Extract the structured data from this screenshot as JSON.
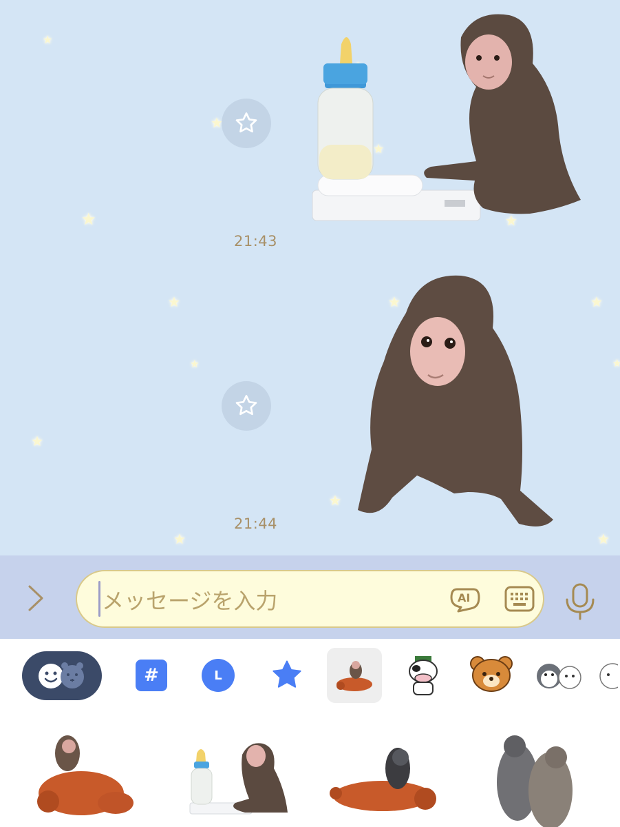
{
  "chat": {
    "messages": [
      {
        "time": "21:43",
        "sticker": "monkey-with-bottle-on-scale"
      },
      {
        "time": "21:44",
        "sticker": "baby-monkey-sitting"
      }
    ],
    "reaction_icon": "star-outline-icon"
  },
  "input": {
    "placeholder": "メッセージを入力",
    "ai_label": "AI",
    "expand_icon": "chevron-right-icon",
    "keyboard_icon": "keyboard-icon",
    "mic_icon": "microphone-icon"
  },
  "sticker_tabs": [
    {
      "name": "emoji-toggle",
      "icon": "emoji-face-icon"
    },
    {
      "name": "hashtag",
      "label": "#"
    },
    {
      "name": "recent",
      "label": "L"
    },
    {
      "name": "favorites",
      "icon": "star-icon"
    },
    {
      "name": "monkey-pack",
      "selected": true
    },
    {
      "name": "cow-pack"
    },
    {
      "name": "bear-pack"
    },
    {
      "name": "penguin-pack"
    },
    {
      "name": "more-pack"
    }
  ],
  "colors": {
    "chat_bg": "#d4e5f5",
    "input_bar_bg": "#c6d2ec",
    "input_field_bg": "#fefcdc",
    "accent_gold": "#a89067",
    "tab_blue": "#4a7ef5",
    "toggle_bg": "#3b4a68"
  }
}
